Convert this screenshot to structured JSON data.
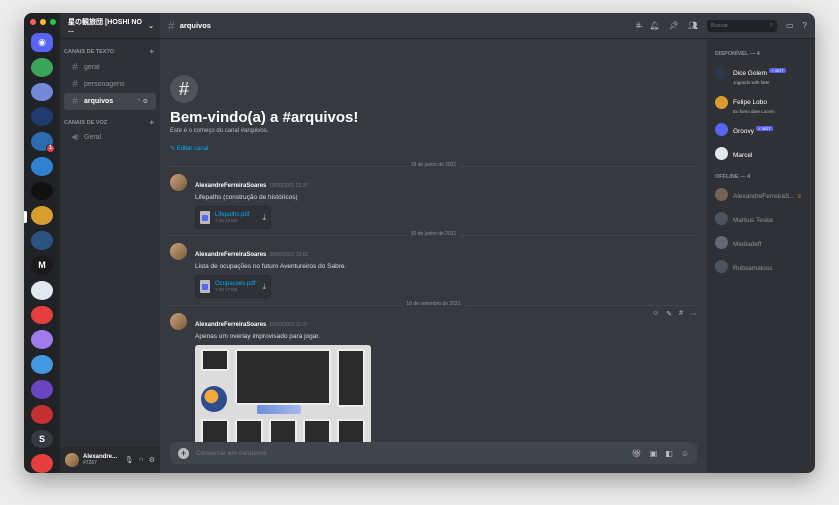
{
  "colors": {
    "accent": "#5865f2",
    "link": "#00aff4",
    "danger": "#ed4245",
    "mac_red": "#ff5f57",
    "mac_yellow": "#febc2e",
    "mac_green": "#28c840"
  },
  "rail": {
    "servers": [
      {
        "icon": "discord-home-icon",
        "color": "#5865f2"
      },
      {
        "icon": "server-icon-1",
        "color": "#3ba55c"
      },
      {
        "icon": "server-icon-2",
        "color": "#7289da"
      },
      {
        "icon": "server-icon-3",
        "color": "#1e3a6e"
      },
      {
        "icon": "server-icon-4",
        "color": "#2b6cb0",
        "badge": "1"
      },
      {
        "icon": "server-icon-5",
        "color": "#3182ce"
      },
      {
        "icon": "server-icon-6",
        "color": "#111111"
      },
      {
        "icon": "server-icon-7",
        "color": "#d69e2e",
        "active": true
      },
      {
        "icon": "server-icon-8",
        "color": "#2c5282"
      },
      {
        "icon": "server-icon-9",
        "color": "#1a1a1a",
        "text": "M"
      },
      {
        "icon": "server-icon-10",
        "color": "#e2e8f0"
      },
      {
        "icon": "server-icon-11",
        "color": "#e53e3e"
      },
      {
        "icon": "server-icon-12",
        "color": "#9f7aea"
      },
      {
        "icon": "server-icon-13",
        "color": "#4299e1"
      },
      {
        "icon": "server-icon-14",
        "color": "#6b46c1"
      },
      {
        "icon": "server-icon-15",
        "color": "#c53030"
      },
      {
        "icon": "server-icon-16",
        "color": "#36393f",
        "text": "S"
      },
      {
        "icon": "server-icon-17",
        "color": "#e53e3e"
      }
    ]
  },
  "guild": {
    "name": "星の観旅団 [HOSHI NO ..."
  },
  "categories": {
    "text": {
      "label": "CANAIS DE TEXTO",
      "channels": [
        "geral",
        "personagens",
        "arquivos"
      ]
    },
    "voice": {
      "label": "CANAIS DE VOZ",
      "channels": [
        "Geral"
      ]
    }
  },
  "user": {
    "name": "Alexandre...",
    "discriminator": "#7267"
  },
  "topbar": {
    "channel": "arquivos",
    "search_placeholder": "Buscar"
  },
  "welcome": {
    "title": "Bem-vindo(a) a #arquivos!",
    "subtitle": "Este é o começo do canal #arquivos.",
    "edit_link": "Editar canal"
  },
  "dividers": [
    "18 de junho de 2021",
    "30 de junho de 2021",
    "16 de setembro de 2021"
  ],
  "messages": [
    {
      "author": "AlexandreFerreiraSoares",
      "time": "18/06/2021 23:37",
      "text": "Lifepaths (construção de históricos)",
      "file": {
        "name": "Lifepaths.pdf",
        "size": "7.15 18 KB"
      }
    },
    {
      "author": "AlexandreFerreiraSoares",
      "time": "30/06/2021 19:01",
      "text": "Lista de ocupações no futuro Aventureiros do Sabre.",
      "file": {
        "name": "Ocupacoes.pdf",
        "size": "7.08 17 KB"
      }
    },
    {
      "author": "AlexandreFerreiraSoares",
      "time": "16/09/2021 11:07",
      "text": "Apenas um overlay improvisado para jogar."
    }
  ],
  "composer": {
    "placeholder": "Conversar em #arquivos"
  },
  "members": {
    "online_label": "DISPONÍVEL — 4",
    "offline_label": "OFFLINE — 4",
    "bot_badge": "✓ BOT",
    "online": [
      {
        "name": "Dice Golem",
        "activity": "Jogando with fate!",
        "bot": true,
        "color": "#2d3748"
      },
      {
        "name": "Felipe Lobo",
        "activity": "Eu fumo dare Lucem",
        "bot": false,
        "color": "#d69e2e"
      },
      {
        "name": "Groovy",
        "activity": "",
        "bot": true,
        "color": "#5865f2"
      },
      {
        "name": "Marcel",
        "activity": "",
        "bot": false,
        "color": "#e2e8f0"
      }
    ],
    "offline": [
      {
        "name": "AlexandreFerreiraS...",
        "crown": true,
        "color": "#c8a27a"
      },
      {
        "name": "Markus Teske",
        "color": "#718096"
      },
      {
        "name": "Mediadeff",
        "color": "#a0aec0"
      },
      {
        "name": "Rubsamaloss",
        "color": "#718096"
      }
    ]
  }
}
